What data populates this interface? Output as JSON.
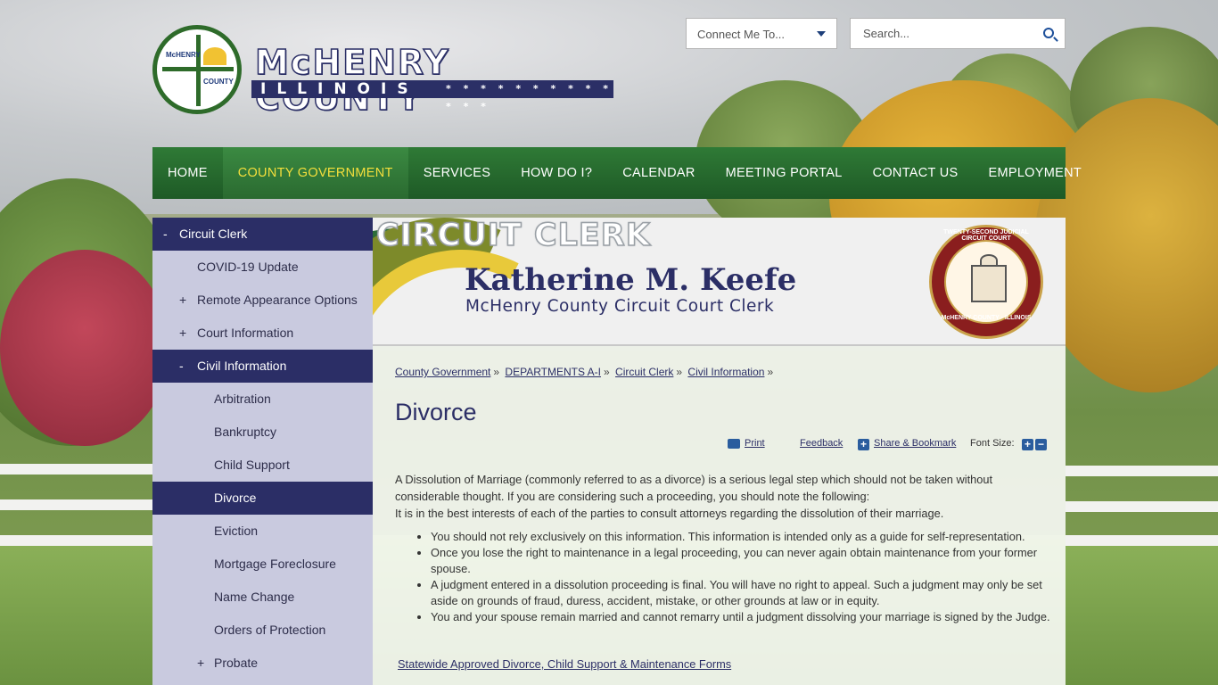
{
  "header": {
    "seal_text_top": "McHENRY",
    "seal_text_bottom": "COUNTY",
    "wordmark": "McHENRY COUNTY",
    "state": "ILLINOIS",
    "stars": "* * * * * * * * * * * * *",
    "connect_label": "Connect Me To...",
    "search_placeholder": "Search..."
  },
  "nav": [
    {
      "label": "HOME",
      "active": false
    },
    {
      "label": "COUNTY GOVERNMENT",
      "active": true
    },
    {
      "label": "SERVICES",
      "active": false
    },
    {
      "label": "HOW DO I?",
      "active": false
    },
    {
      "label": "CALENDAR",
      "active": false
    },
    {
      "label": "MEETING PORTAL",
      "active": false
    },
    {
      "label": "CONTACT US",
      "active": false
    },
    {
      "label": "EMPLOYMENT",
      "active": false
    }
  ],
  "sidebar": {
    "top": {
      "label": "Circuit Clerk",
      "toggle": "-"
    },
    "items": [
      {
        "label": "COVID-19 Update",
        "toggle": ""
      },
      {
        "label": "Remote Appearance Options",
        "toggle": "+"
      },
      {
        "label": "Court Information",
        "toggle": "+"
      },
      {
        "label": "Civil Information",
        "toggle": "-"
      }
    ],
    "subitems": [
      {
        "label": "Arbitration",
        "toggle": ""
      },
      {
        "label": "Bankruptcy",
        "toggle": ""
      },
      {
        "label": "Child Support",
        "toggle": ""
      },
      {
        "label": "Divorce",
        "toggle": ""
      },
      {
        "label": "Eviction",
        "toggle": ""
      },
      {
        "label": "Mortgage Foreclosure",
        "toggle": ""
      },
      {
        "label": "Name Change",
        "toggle": ""
      },
      {
        "label": "Orders of Protection",
        "toggle": ""
      },
      {
        "label": "Probate",
        "toggle": "+"
      }
    ]
  },
  "banner": {
    "title": "CIRCUIT CLERK",
    "name": "Katherine M. Keefe",
    "subtitle": "McHenry County Circuit Court Clerk",
    "seal_top": "TWENTY-SECOND JUDICIAL CIRCUIT COURT",
    "seal_bottom": "McHENRY COUNTY · ILLINOIS"
  },
  "breadcrumb": [
    "County Government",
    "DEPARTMENTS A-I",
    "Circuit Clerk",
    "Civil Information"
  ],
  "page_title": "Divorce",
  "tools": {
    "print": "Print",
    "feedback": "Feedback",
    "share": "Share & Bookmark",
    "font_size": "Font Size:",
    "increase": "+",
    "decrease": "−"
  },
  "content": {
    "intro": "A Dissolution of Marriage (commonly referred to as a divorce) is a serious legal step which should not be taken without considerable thought. If you are considering such a proceeding, you should note the following:",
    "intro2": "It is in the best interests of each of the parties to consult attorneys regarding the dissolution of their marriage.",
    "bullets": [
      "You should not rely exclusively on this information. This information is intended only as a guide for self-representation.",
      "Once you lose the right to maintenance in a legal proceeding, you can never again obtain maintenance from your former spouse.",
      "A judgment entered in a dissolution proceeding is final. You will have no right to appeal. Such a judgment may only be set aside on grounds of fraud, duress, accident, mistake, or other grounds at law or in equity.",
      "You and your spouse remain married and cannot remarry until a judgment dissolving your marriage is signed by the Judge."
    ],
    "forms_link": "Statewide Approved Divorce, Child Support & Maintenance Forms"
  },
  "colors": {
    "navy": "#2b2e66",
    "nav_green": "#2f7a36",
    "nav_active_text": "#f5df3c",
    "sidebar_bg": "#c9cadf"
  }
}
